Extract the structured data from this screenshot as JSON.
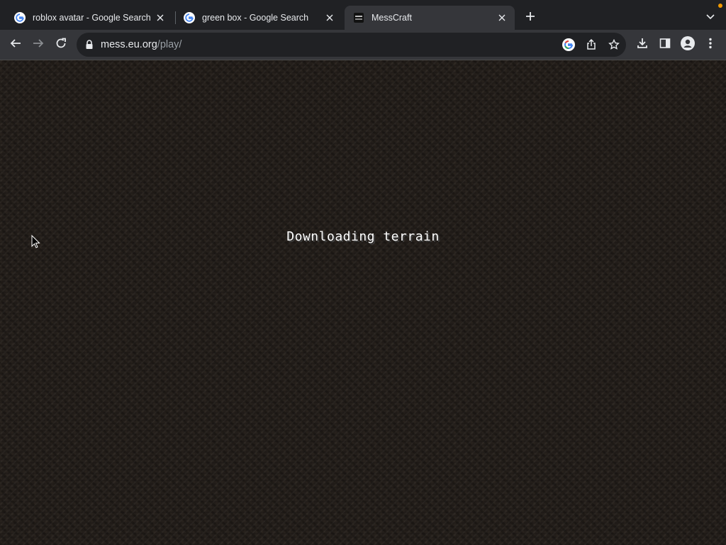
{
  "browser": {
    "tabs": [
      {
        "title": "roblox avatar - Google Search",
        "favicon": "google-g-icon",
        "active": false
      },
      {
        "title": "green box - Google Search",
        "favicon": "google-g-icon",
        "active": false
      },
      {
        "title": "MessCraft",
        "favicon": "messcraft-icon",
        "active": true
      }
    ],
    "address": {
      "host": "mess.eu.org",
      "path": "/play/"
    },
    "icons": {
      "back": "back-arrow-icon",
      "forward": "forward-arrow-icon",
      "reload": "reload-icon",
      "lock": "lock-icon",
      "google_lens": "google-icon",
      "share": "share-icon",
      "bookmark": "star-icon",
      "downloads": "download-icon",
      "side_panel": "side-panel-icon",
      "profile": "profile-icon",
      "menu": "kebab-menu-icon",
      "new_tab": "plus-icon",
      "tab_search": "chevron-down-icon"
    },
    "colors": {
      "tabstrip": "#202124",
      "toolbar": "#35363a",
      "omnibox": "#202124",
      "notification_dot": "#f29900"
    }
  },
  "game": {
    "status": "Downloading terrain",
    "background_color": "#231e1a"
  }
}
